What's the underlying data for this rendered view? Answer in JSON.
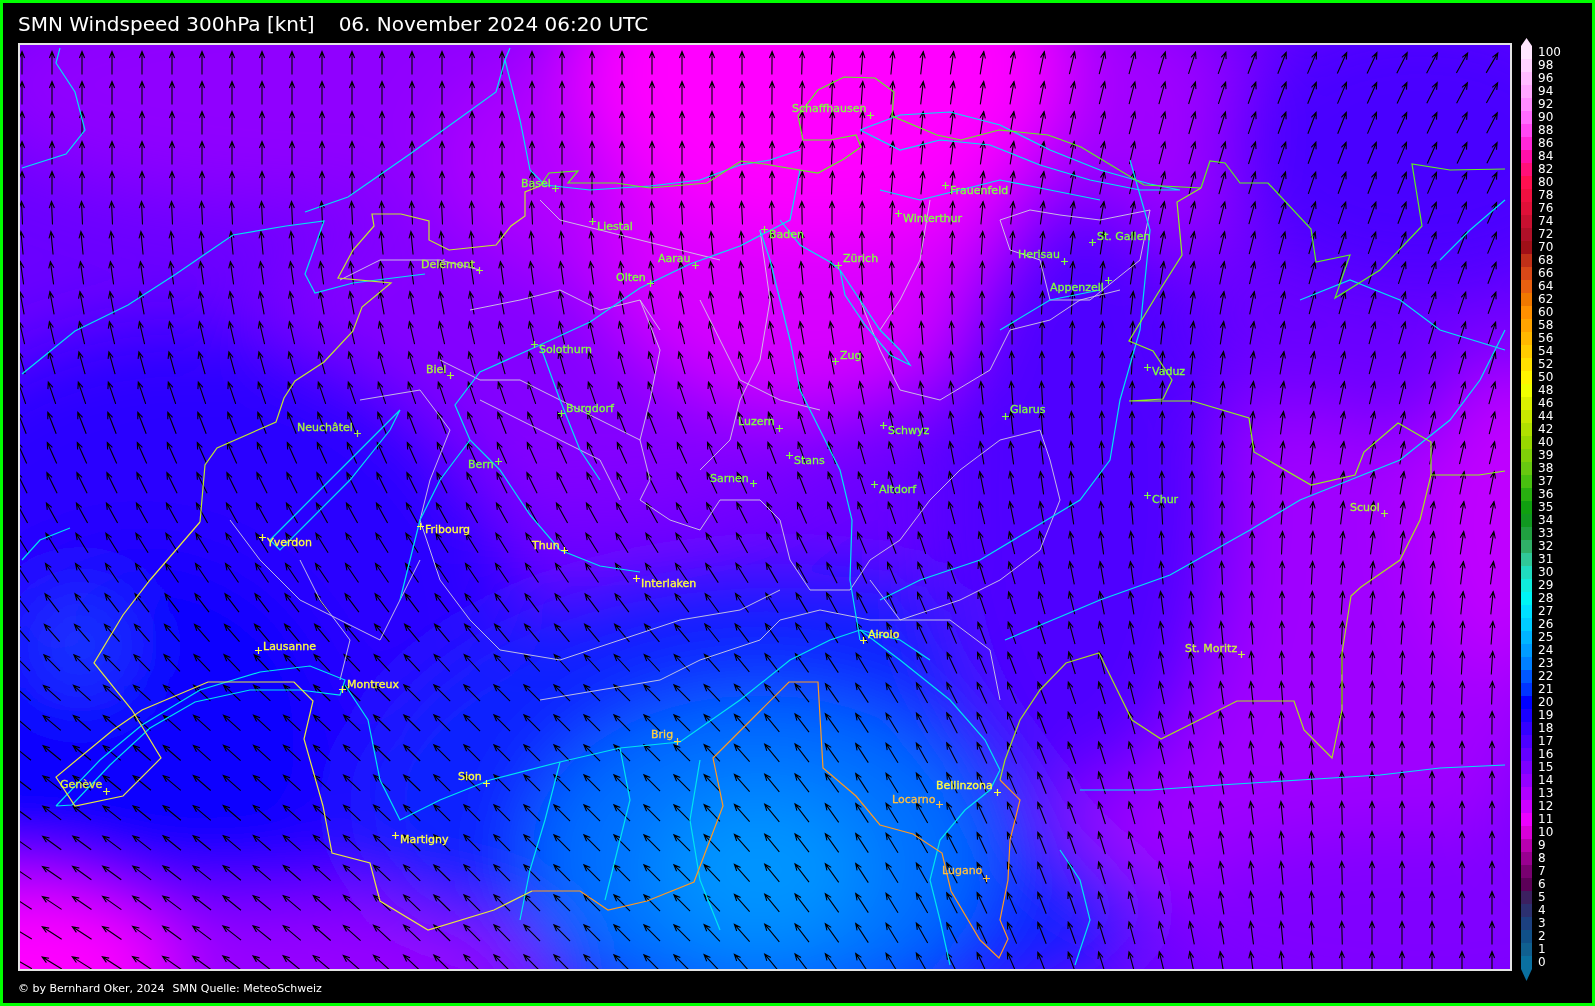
{
  "header": {
    "title": "SMN Windspeed 300hPa [knt]",
    "timestamp": "06. November 2024 06:20 UTC"
  },
  "map": {
    "cities": [
      {
        "name": "Schaffhausen",
        "color": "#80ff40"
      },
      {
        "name": "Basel",
        "color": "#80ff40"
      },
      {
        "name": "Frauenfeld",
        "color": "#80ff40"
      },
      {
        "name": "Winterthur",
        "color": "#80ff40"
      },
      {
        "name": "Liestal",
        "color": "#80ff40"
      },
      {
        "name": "Baden",
        "color": "#80ff40"
      },
      {
        "name": "St. Gallen",
        "color": "#80ff40"
      },
      {
        "name": "Herisau",
        "color": "#80ff40"
      },
      {
        "name": "Aarau",
        "color": "#80ff40"
      },
      {
        "name": "Zürich",
        "color": "#80ff40"
      },
      {
        "name": "Delémont",
        "color": "#a8f040"
      },
      {
        "name": "Olten",
        "color": "#80ff40"
      },
      {
        "name": "Appenzell",
        "color": "#80ff40"
      },
      {
        "name": "Solothurn",
        "color": "#80ff40"
      },
      {
        "name": "Zug",
        "color": "#80ff40"
      },
      {
        "name": "Biel",
        "color": "#a8f040"
      },
      {
        "name": "Vaduz",
        "color": "#80ff40"
      },
      {
        "name": "Burgdorf",
        "color": "#80ff40"
      },
      {
        "name": "Glarus",
        "color": "#80ff40"
      },
      {
        "name": "Luzern",
        "color": "#80ff40"
      },
      {
        "name": "Neuchâtel",
        "color": "#a8f040"
      },
      {
        "name": "Schwyz",
        "color": "#80ff40"
      },
      {
        "name": "Stans",
        "color": "#80ff40"
      },
      {
        "name": "Bern",
        "color": "#80ff40"
      },
      {
        "name": "Sarnen",
        "color": "#80ff40"
      },
      {
        "name": "Altdorf",
        "color": "#80ff40"
      },
      {
        "name": "Chur",
        "color": "#80ff40"
      },
      {
        "name": "Scuol",
        "color": "#a8f040"
      },
      {
        "name": "Fribourg",
        "color": "#ffff40"
      },
      {
        "name": "Yverdon",
        "color": "#ffff40"
      },
      {
        "name": "Thun",
        "color": "#ffff40"
      },
      {
        "name": "Interlaken",
        "color": "#ffff40"
      },
      {
        "name": "Airolo",
        "color": "#ffff40"
      },
      {
        "name": "Lausanne",
        "color": "#ffff40"
      },
      {
        "name": "St. Moritz",
        "color": "#c8f040"
      },
      {
        "name": "Montreux",
        "color": "#ffff40"
      },
      {
        "name": "Brig",
        "color": "#ffd040"
      },
      {
        "name": "Sion",
        "color": "#ffff40"
      },
      {
        "name": "Genève",
        "color": "#e0f040"
      },
      {
        "name": "Bellinzona",
        "color": "#ffff40"
      },
      {
        "name": "Locarno",
        "color": "#ffc040"
      },
      {
        "name": "Martigny",
        "color": "#ffff40"
      },
      {
        "name": "Lugano",
        "color": "#ffc040"
      }
    ]
  },
  "color_scale": {
    "items": [
      {
        "label": "100",
        "color": "#ffe6ff"
      },
      {
        "label": "98",
        "color": "#ffd2ff"
      },
      {
        "label": "96",
        "color": "#ffbcff"
      },
      {
        "label": "94",
        "color": "#ffa6ff"
      },
      {
        "label": "92",
        "color": "#ff8cff"
      },
      {
        "label": "90",
        "color": "#ff6cff"
      },
      {
        "label": "88",
        "color": "#ff48f4"
      },
      {
        "label": "86",
        "color": "#ff28d8"
      },
      {
        "label": "84",
        "color": "#ff10a8"
      },
      {
        "label": "82",
        "color": "#ff1078"
      },
      {
        "label": "80",
        "color": "#ff1050"
      },
      {
        "label": "78",
        "color": "#f01040"
      },
      {
        "label": "76",
        "color": "#e01038"
      },
      {
        "label": "74",
        "color": "#c81030"
      },
      {
        "label": "72",
        "color": "#b01028"
      },
      {
        "label": "70",
        "color": "#a01018"
      },
      {
        "label": "68",
        "color": "#c03018"
      },
      {
        "label": "66",
        "color": "#d84818"
      },
      {
        "label": "64",
        "color": "#e86010"
      },
      {
        "label": "62",
        "color": "#f07800"
      },
      {
        "label": "60",
        "color": "#ff9000"
      },
      {
        "label": "58",
        "color": "#ffa400"
      },
      {
        "label": "56",
        "color": "#ffb800"
      },
      {
        "label": "54",
        "color": "#ffcc00"
      },
      {
        "label": "52",
        "color": "#ffe000"
      },
      {
        "label": "50",
        "color": "#fff400"
      },
      {
        "label": "48",
        "color": "#f0ff00"
      },
      {
        "label": "46",
        "color": "#dcf000"
      },
      {
        "label": "44",
        "color": "#c8e800"
      },
      {
        "label": "42",
        "color": "#b0e000"
      },
      {
        "label": "40",
        "color": "#98d800"
      },
      {
        "label": "39",
        "color": "#80d008"
      },
      {
        "label": "38",
        "color": "#68c810"
      },
      {
        "label": "37",
        "color": "#48c010"
      },
      {
        "label": "36",
        "color": "#28b010"
      },
      {
        "label": "35",
        "color": "#10a010"
      },
      {
        "label": "34",
        "color": "#109820"
      },
      {
        "label": "33",
        "color": "#20a040"
      },
      {
        "label": "32",
        "color": "#30b068"
      },
      {
        "label": "31",
        "color": "#30c898"
      },
      {
        "label": "30",
        "color": "#20dcc0"
      },
      {
        "label": "29",
        "color": "#10ecdc"
      },
      {
        "label": "28",
        "color": "#00f4f4"
      },
      {
        "label": "27",
        "color": "#00e0ff"
      },
      {
        "label": "26",
        "color": "#00ccff"
      },
      {
        "label": "25",
        "color": "#00b4ff"
      },
      {
        "label": "24",
        "color": "#009cff"
      },
      {
        "label": "23",
        "color": "#0080ff"
      },
      {
        "label": "22",
        "color": "#0058ff"
      },
      {
        "label": "21",
        "color": "#0034ff"
      },
      {
        "label": "20",
        "color": "#0000ff"
      },
      {
        "label": "19",
        "color": "#1a00ff"
      },
      {
        "label": "18",
        "color": "#3400ff"
      },
      {
        "label": "17",
        "color": "#4c00ff"
      },
      {
        "label": "16",
        "color": "#6400ff"
      },
      {
        "label": "15",
        "color": "#7c00ff"
      },
      {
        "label": "14",
        "color": "#9400ff"
      },
      {
        "label": "13",
        "color": "#b000ff"
      },
      {
        "label": "12",
        "color": "#cc00ff"
      },
      {
        "label": "11",
        "color": "#ec00ff"
      },
      {
        "label": "10",
        "color": "#d800d8"
      },
      {
        "label": "9",
        "color": "#b800b0"
      },
      {
        "label": "8",
        "color": "#980090"
      },
      {
        "label": "7",
        "color": "#780070"
      },
      {
        "label": "6",
        "color": "#5c0058"
      },
      {
        "label": "5",
        "color": "#3c2060"
      },
      {
        "label": "4",
        "color": "#2c3070"
      },
      {
        "label": "3",
        "color": "#1c4080"
      },
      {
        "label": "2",
        "color": "#105088"
      },
      {
        "label": "1",
        "color": "#106090"
      },
      {
        "label": "0",
        "color": "#0a70a0"
      }
    ]
  },
  "footer": {
    "credit": "© by Bernhard Oker, 2024",
    "source": "SMN Quelle: MeteoSchweiz"
  }
}
